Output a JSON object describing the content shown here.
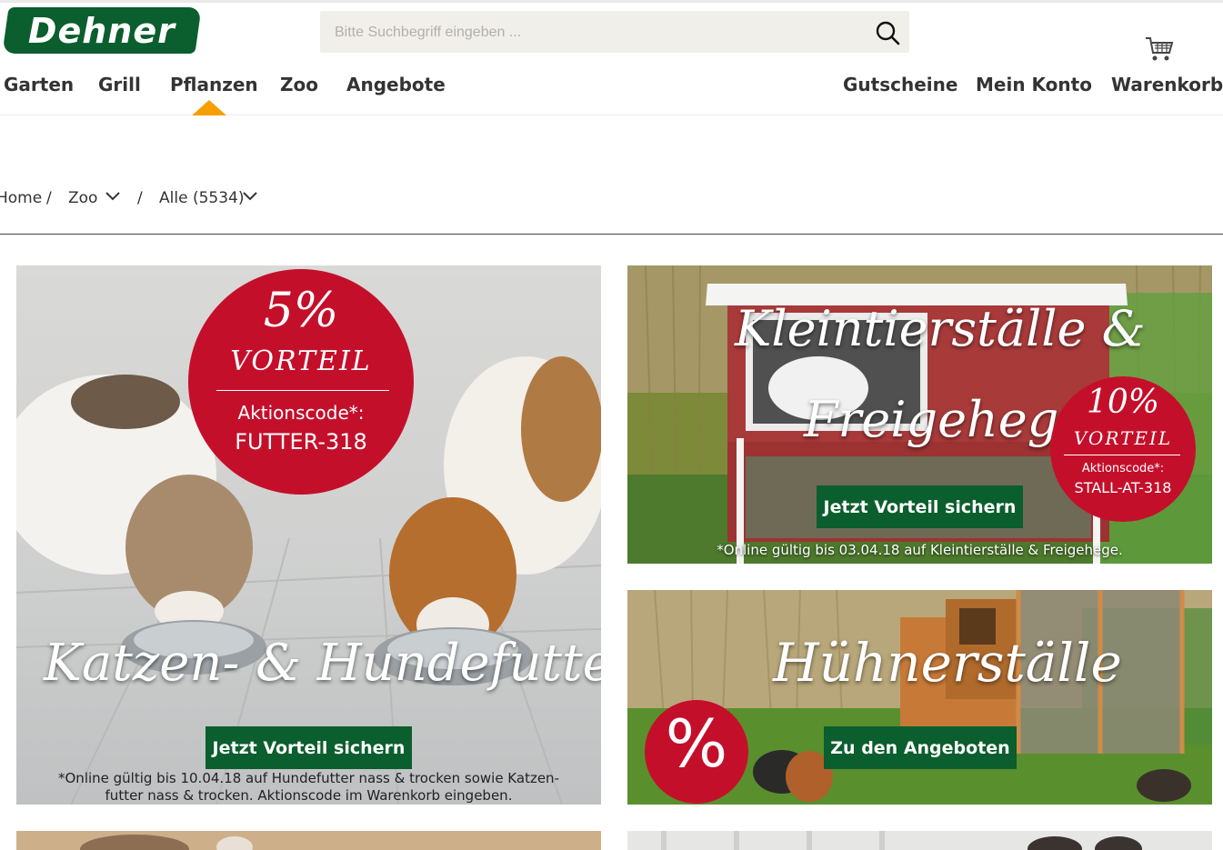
{
  "header": {
    "logo_text": "Dehner",
    "search_placeholder": "Bitte Suchbegriff eingeben ...",
    "search_icon": "magnifier-icon",
    "cart_icon": "shopping-cart-icon"
  },
  "nav": {
    "left": [
      "Garten",
      "Grill",
      "Pflanzen",
      "Zoo",
      "Angebote"
    ],
    "right": [
      "Gutscheine",
      "Mein Konto",
      "Warenkorb"
    ],
    "active": "Pflanzen"
  },
  "breadcrumb": {
    "home": "Home",
    "separator": "/",
    "level1": "Zoo",
    "level2": "Alle (5534)"
  },
  "banners": {
    "food": {
      "headline": "Katzen- & Hundefutter",
      "badge_percent": "5%",
      "badge_vorteil": "VORTEIL",
      "badge_code_label": "Aktionscode*:",
      "badge_code": "FUTTER-318",
      "button": "Jetzt Vorteil sichern",
      "disclaimer_line1": "*Online gültig bis 10.04.18 auf Hundefutter nass & trocken sowie Katzen-",
      "disclaimer_line2": "futter nass & trocken. Aktionscode im Warenkorb eingeben."
    },
    "hutch": {
      "headline_line1": "Kleintierställe &",
      "headline_line2": "Freigehege",
      "badge_percent": "10%",
      "badge_vorteil": "VORTEIL",
      "badge_code_label": "Aktionscode*:",
      "badge_code": "STALL-AT-318",
      "button": "Jetzt Vorteil sichern",
      "disclaimer": "*Online gültig bis 03.04.18 auf Kleintierställe & Freigehege."
    },
    "coop": {
      "headline": "Hühnerställe",
      "badge_symbol": "%",
      "button": "Zu den Angeboten"
    }
  },
  "colors": {
    "brand_green": "#0b5e2d",
    "promo_red": "#c40f2b",
    "nav_indicator": "#f5a000",
    "search_bg": "#f1efe9"
  }
}
